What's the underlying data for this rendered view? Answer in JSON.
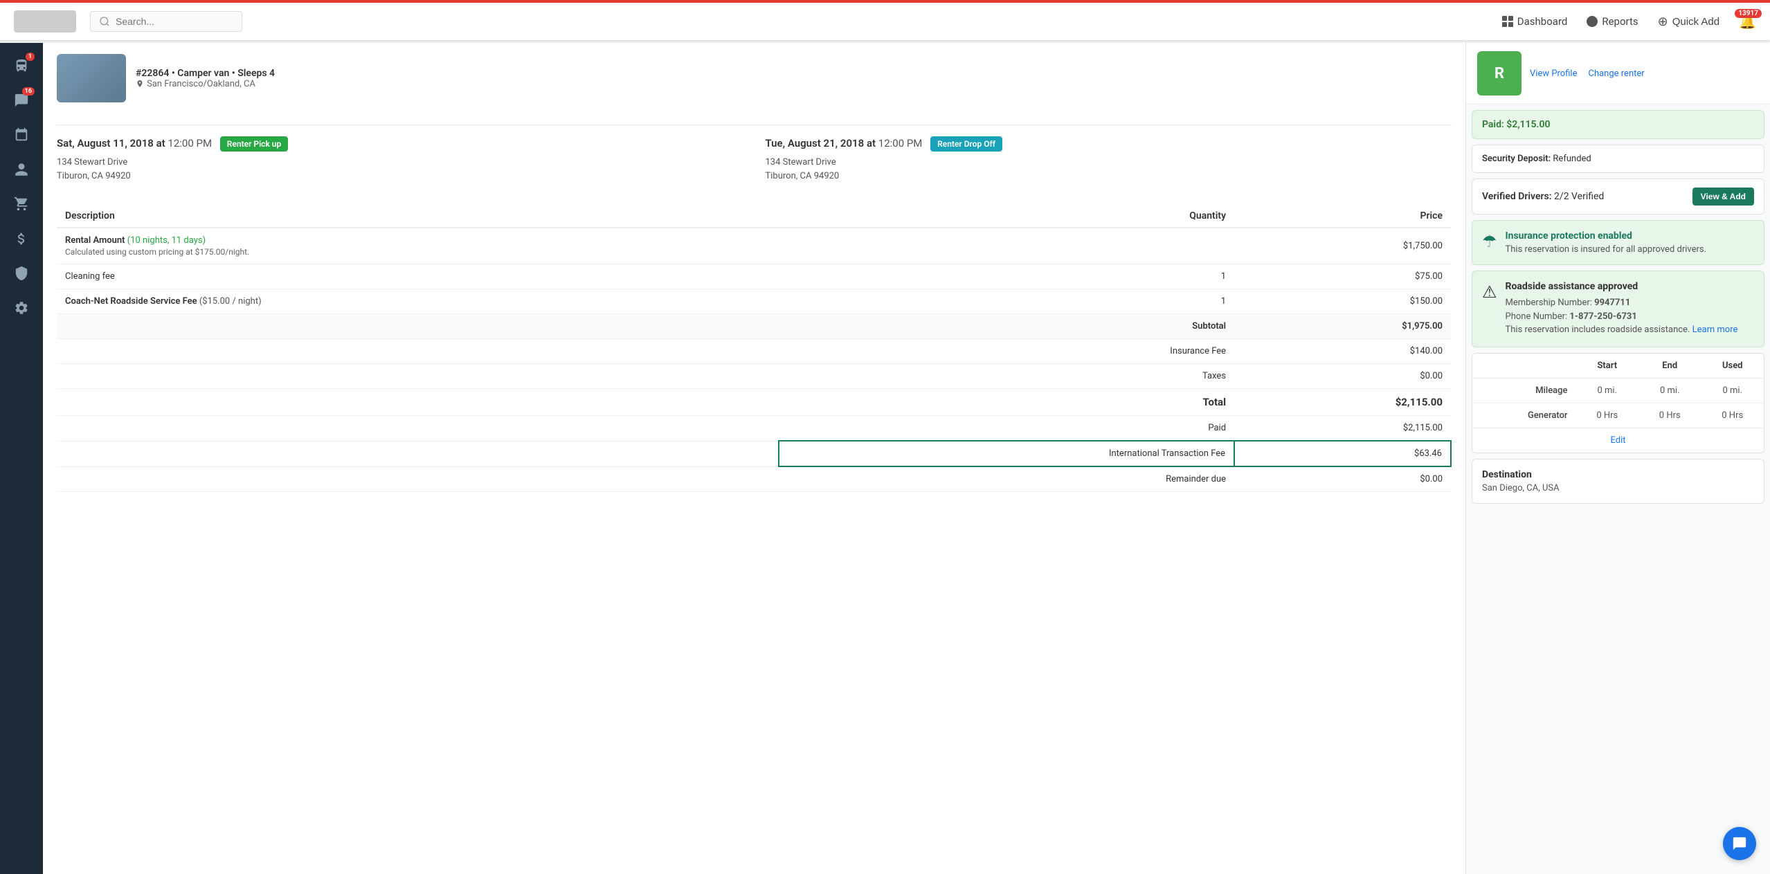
{
  "topnav": {
    "search_placeholder": "Search...",
    "dashboard_label": "Dashboard",
    "reports_label": "Reports",
    "quick_add_label": "Quick Add",
    "notification_count": "13917"
  },
  "sidebar": {
    "items": [
      {
        "id": "vehicles",
        "icon": "🚌",
        "badge": "1"
      },
      {
        "id": "messages",
        "icon": "💬",
        "badge": "16"
      },
      {
        "id": "calendar",
        "icon": "📅",
        "badge": null
      },
      {
        "id": "users",
        "icon": "👤",
        "badge": null
      },
      {
        "id": "cart",
        "icon": "🛒",
        "badge": null
      },
      {
        "id": "finances",
        "icon": "💵",
        "badge": null
      },
      {
        "id": "shield",
        "icon": "🛡",
        "badge": null
      },
      {
        "id": "settings",
        "icon": "⚙",
        "badge": null
      }
    ]
  },
  "vehicle": {
    "booking_id": "#22864",
    "type": "Camper van",
    "capacity": "Sleeps 4",
    "location": "San Francisco/Oakland, CA",
    "pickup_date": "Sat, August 11, 2018",
    "pickup_time": "12:00 PM",
    "pickup_badge": "Renter Pick up",
    "pickup_address1": "134 Stewart Drive",
    "pickup_address2": "Tiburon, CA 94920",
    "dropoff_date": "Tue, August 21, 2018",
    "dropoff_time": "12:00 PM",
    "dropoff_badge": "Renter Drop Off",
    "dropoff_address1": "134 Stewart Drive",
    "dropoff_address2": "Tiburon, CA 94920"
  },
  "invoice": {
    "headers": [
      "Description",
      "Quantity",
      "Price"
    ],
    "rows": [
      {
        "description": "Rental Amount",
        "nights_label": "(10 nights, 11 days)",
        "calc": "Calculated using custom pricing at $175.00/night.",
        "quantity": "",
        "price": "$1,750.00"
      },
      {
        "description": "Cleaning fee",
        "quantity": "1",
        "price": "$75.00"
      },
      {
        "description": "Coach-Net Roadside Service Fee",
        "nights_label": "($15.00 / night)",
        "quantity": "1",
        "price": "$150.00"
      }
    ],
    "subtotal_label": "Subtotal",
    "subtotal_value": "$1,975.00",
    "insurance_fee_label": "Insurance Fee",
    "insurance_fee_value": "$140.00",
    "taxes_label": "Taxes",
    "taxes_value": "$0.00",
    "total_label": "Total",
    "total_value": "$2,115.00",
    "paid_label": "Paid",
    "paid_value": "$2,115.00",
    "intl_fee_label": "International Transaction Fee",
    "intl_fee_value": "$63.46",
    "remainder_label": "Remainder due",
    "remainder_value": "$0.00"
  },
  "right_panel": {
    "view_profile_label": "View Profile",
    "change_renter_label": "Change renter",
    "paid_label": "Paid:",
    "paid_value": "$2,115.00",
    "deposit_label": "Security Deposit:",
    "deposit_value": "Refunded",
    "drivers_label": "Verified Drivers:",
    "drivers_value": "2/2 Verified",
    "view_add_label": "View & Add",
    "insurance_title": "Insurance protection enabled",
    "insurance_text": "This reservation is insured for all approved drivers.",
    "roadside_title": "Roadside assistance approved",
    "roadside_membership": "Membership Number:",
    "roadside_membership_value": "9947711",
    "roadside_phone": "Phone Number:",
    "roadside_phone_value": "1-877-250-6731",
    "roadside_text": "This reservation includes roadside assistance.",
    "roadside_link": "Learn more",
    "mileage": {
      "headers": [
        "",
        "Start",
        "End",
        "Used"
      ],
      "rows": [
        {
          "label": "Mileage",
          "start": "0 mi.",
          "end": "0 mi.",
          "used": "0 mi."
        },
        {
          "label": "Generator",
          "start": "0 Hrs",
          "end": "0 Hrs",
          "used": "0 Hrs"
        }
      ],
      "edit_label": "Edit"
    },
    "destination_title": "Destination",
    "destination_value": "San Diego, CA, USA"
  }
}
